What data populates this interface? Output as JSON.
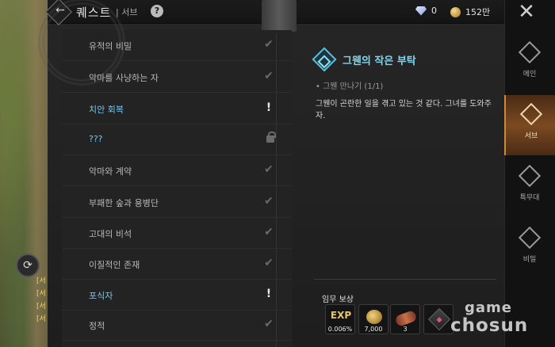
{
  "header": {
    "title": "퀘스트",
    "subtitle": "| 서브",
    "help_label": "?",
    "back_label": "←",
    "gems": "0",
    "gold": "152만"
  },
  "quests": [
    {
      "label": "유적의 비밀",
      "status": "check",
      "highlight": false
    },
    {
      "label": "악마를 사냥하는 자",
      "status": "check",
      "highlight": false
    },
    {
      "label": "치안 회복",
      "status": "exclaim",
      "highlight": true
    },
    {
      "label": "???",
      "status": "lock",
      "highlight": true
    },
    {
      "label": "악마와 계약",
      "status": "check",
      "highlight": false
    },
    {
      "label": "부패한 숲과 용병단",
      "status": "check",
      "highlight": false
    },
    {
      "label": "고대의 비석",
      "status": "check",
      "highlight": false
    },
    {
      "label": "이질적인 존재",
      "status": "check",
      "highlight": false
    },
    {
      "label": "포식자",
      "status": "exclaim",
      "highlight": true
    },
    {
      "label": "정적",
      "status": "check",
      "highlight": false
    }
  ],
  "detail": {
    "title": "그웬의 작은 부탁",
    "objective": "• 그웬 만나기 (1/1)",
    "description": "그웬이 곤란한 일을 겪고 있는 것 같다. 그녀를 도와주자.",
    "reward_label": "임무 보상",
    "rewards": [
      {
        "name": "EXP",
        "value": "0.006%"
      },
      {
        "name": "gold",
        "value": "7,000"
      },
      {
        "name": "meat",
        "value": "3"
      },
      {
        "name": "scroll",
        "value": ""
      }
    ]
  },
  "tabs": [
    {
      "label": "메인",
      "active": false
    },
    {
      "label": "서브",
      "active": true
    },
    {
      "label": "특무대",
      "active": false
    },
    {
      "label": "비밀",
      "active": false
    }
  ],
  "chat_lines": [
    "[서",
    "[서",
    "[서",
    "[서"
  ],
  "watermark": {
    "line1": "game",
    "line2": "chosun"
  }
}
